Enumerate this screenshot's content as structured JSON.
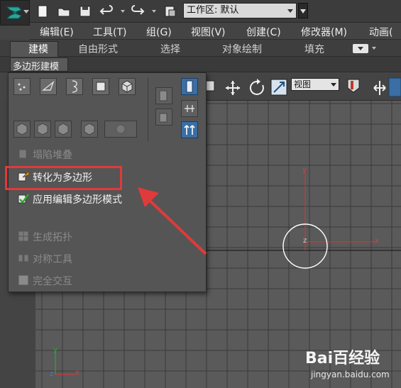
{
  "toolbar": {
    "workspace_label": "工作区: 默认",
    "icons": [
      "new-file-icon",
      "open-folder-icon",
      "save-icon",
      "undo-icon",
      "redo-icon",
      "project-folder-icon"
    ]
  },
  "menu": {
    "items": [
      "编辑(E)",
      "工具(T)",
      "组(G)",
      "视图(V)",
      "创建(C)",
      "修改器(M)",
      "动画("
    ]
  },
  "ribbon": {
    "tabs": [
      "建模",
      "自由形式",
      "选择",
      "对象绘制",
      "填充"
    ],
    "active_tab": "建模"
  },
  "poly_strip": {
    "label": "多边形建模"
  },
  "right_toolbar": {
    "view_select": "视图"
  },
  "panel": {
    "commands": [
      {
        "label": "塌陷堆叠",
        "icon": "collapse-stack-icon",
        "enabled": false
      },
      {
        "label": "转化为多边形",
        "icon": "convert-to-poly-icon",
        "enabled": true,
        "highlighted": true
      },
      {
        "label": "应用编辑多边形模式",
        "icon": "apply-edit-poly-icon",
        "enabled": true
      },
      {
        "label": "生成拓扑",
        "icon": "generate-topology-icon",
        "enabled": false
      },
      {
        "label": "对称工具",
        "icon": "symmetry-tools-icon",
        "enabled": false
      },
      {
        "label": "完全交互",
        "icon": "full-interactivity-checkbox",
        "enabled": false
      }
    ]
  },
  "viewport": {
    "axis_x": "x",
    "axis_y": "y",
    "axis_z": "z"
  },
  "watermark": {
    "brand": "Bai百经验",
    "sub": "jingyan.baidu.com"
  },
  "colors": {
    "highlight": "#e03a3a",
    "arrow": "#e03a3a",
    "selected_blue": "#3a6ea5"
  }
}
